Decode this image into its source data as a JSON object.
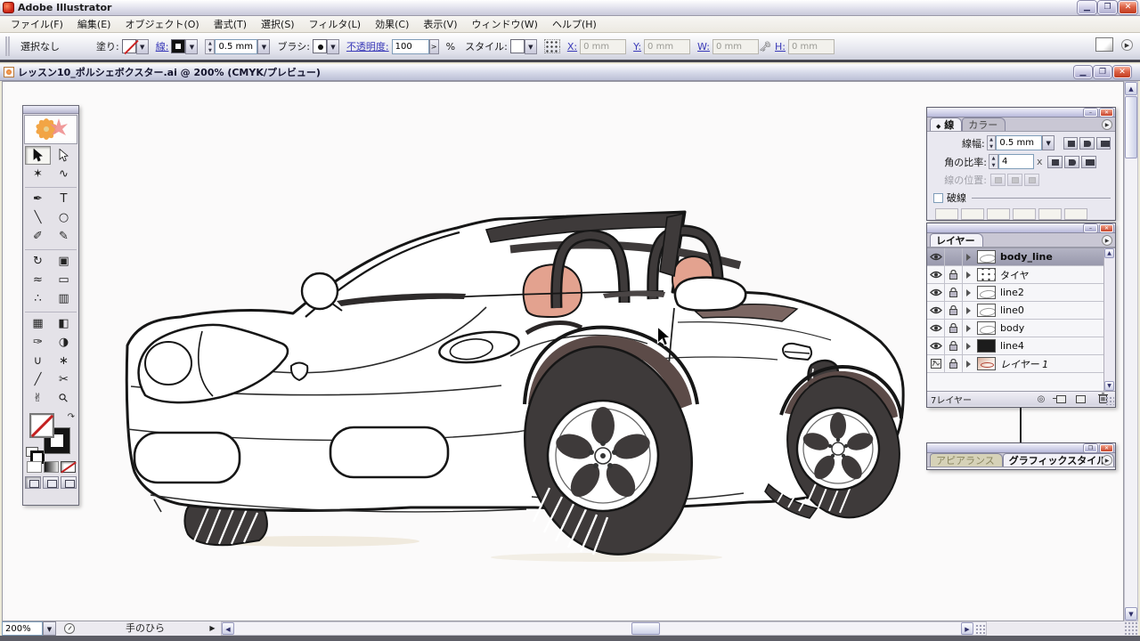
{
  "window": {
    "title": "Adobe Illustrator"
  },
  "menu_bar": {
    "items": [
      "ファイル(F)",
      "編集(E)",
      "オブジェクト(O)",
      "書式(T)",
      "選択(S)",
      "フィルタ(L)",
      "効果(C)",
      "表示(V)",
      "ウィンドウ(W)",
      "ヘルプ(H)"
    ]
  },
  "options_bar": {
    "selection_status": "選択なし",
    "fill_label": "塗り:",
    "stroke_label": "線:",
    "stroke_width": "0.5 mm",
    "brush_label": "ブラシ:",
    "opacity_label": "不透明度:",
    "opacity_value": "100",
    "opacity_unit": "%",
    "style_label": "スタイル:",
    "x_label": "X:",
    "x_value": "0 mm",
    "y_label": "Y:",
    "y_value": "0 mm",
    "w_label": "W:",
    "w_value": "0 mm",
    "h_label": "H:",
    "h_value": "0 mm"
  },
  "document": {
    "title": "レッスン10_ポルシェボクスター.ai @ 200% (CMYK/プレビュー)"
  },
  "toolbox": {
    "selected": "selection-tool",
    "groups": [
      [
        "selection-tool",
        "direct-selection-tool",
        "magic-wand-tool",
        "lasso-tool"
      ],
      [
        "pen-tool",
        "type-tool",
        "line-segment-tool",
        "ellipse-tool",
        "paintbrush-tool",
        "pencil-tool"
      ],
      [
        "rotate-tool",
        "scale-tool",
        "warp-tool",
        "free-transform-tool",
        "symbol-sprayer-tool",
        "graph-tool"
      ],
      [
        "mesh-tool",
        "gradient-tool",
        "eyedropper-tool",
        "blend-tool",
        "live-paint-bucket-tool",
        "live-paint-selection-tool",
        "slice-tool",
        "scissors-tool",
        "hand-tool",
        "zoom-tool"
      ]
    ]
  },
  "stroke_panel": {
    "tab_marker": "◆",
    "tabs": [
      "線",
      "カラー"
    ],
    "weight_label": "線幅:",
    "weight_value": "0.5 mm",
    "miter_label": "角の比率:",
    "miter_value": "4",
    "miter_unit": "x",
    "align_label": "線の位置:",
    "dash_label": "破線"
  },
  "layers_panel": {
    "tab": "レイヤー",
    "status": "7レイヤー",
    "layers": [
      {
        "name": "body_line",
        "selected": true,
        "locked": false,
        "visible": true,
        "template": false,
        "italic": false,
        "thumb": "sketch"
      },
      {
        "name": "タイヤ",
        "selected": false,
        "locked": true,
        "visible": true,
        "template": false,
        "italic": false,
        "thumb": "dots"
      },
      {
        "name": "line2",
        "selected": false,
        "locked": true,
        "visible": true,
        "template": false,
        "italic": false,
        "thumb": "sketch"
      },
      {
        "name": "line0",
        "selected": false,
        "locked": true,
        "visible": true,
        "template": false,
        "italic": false,
        "thumb": "sketch"
      },
      {
        "name": "body",
        "selected": false,
        "locked": true,
        "visible": true,
        "template": false,
        "italic": false,
        "thumb": "sketch"
      },
      {
        "name": "line4",
        "selected": false,
        "locked": true,
        "visible": true,
        "template": false,
        "italic": false,
        "thumb": "black"
      },
      {
        "name": "レイヤー 1",
        "selected": false,
        "locked": true,
        "visible": true,
        "template": true,
        "italic": true,
        "thumb": "photo"
      }
    ]
  },
  "styles_panel": {
    "tabs": [
      "アピアランス",
      "グラフィックスタイル"
    ]
  },
  "status_bar": {
    "zoom": "200%",
    "tool_status": "手のひら"
  },
  "colors": {
    "trim": "#3e3a3a",
    "seat": "#e3a28f",
    "arch": "#5c4b48",
    "mauve": "#7b6662",
    "line": "#161616",
    "canvas": "#fbfafa"
  }
}
